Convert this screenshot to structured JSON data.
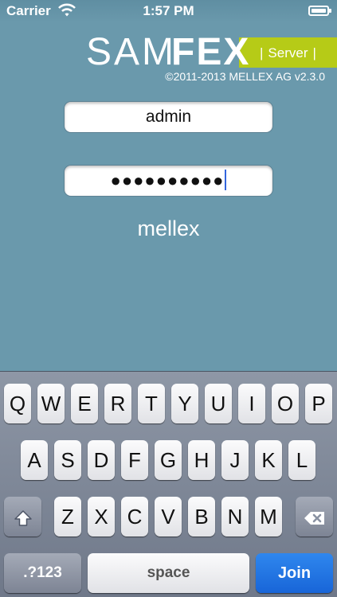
{
  "status_bar": {
    "carrier": "Carrier",
    "time": "1:57 PM",
    "icons": [
      "wifi-icon",
      "battery-icon"
    ]
  },
  "header": {
    "logo_sam": "SAM",
    "logo_fex": "FEX",
    "server_pipe_left": "|",
    "server_label": "Server",
    "server_pipe_right": "|",
    "copyright": "©2011-2013 MELLEX AG v2.3.0"
  },
  "form": {
    "username_value": "admin",
    "password_value": "●●●●●●●●●●",
    "organization": "mellex"
  },
  "keyboard": {
    "row1": [
      "Q",
      "W",
      "E",
      "R",
      "T",
      "Y",
      "U",
      "I",
      "O",
      "P"
    ],
    "row2": [
      "A",
      "S",
      "D",
      "F",
      "G",
      "H",
      "J",
      "K",
      "L"
    ],
    "row3": [
      "Z",
      "X",
      "C",
      "V",
      "B",
      "N",
      "M"
    ],
    "numbers_label": ".?123",
    "space_label": "space",
    "join_label": "Join",
    "icons": [
      "shift-icon",
      "backspace-icon"
    ]
  },
  "colors": {
    "background": "#6a99ac",
    "logo_accent": "#b6cb17",
    "join_key": "#1e6fe0"
  }
}
